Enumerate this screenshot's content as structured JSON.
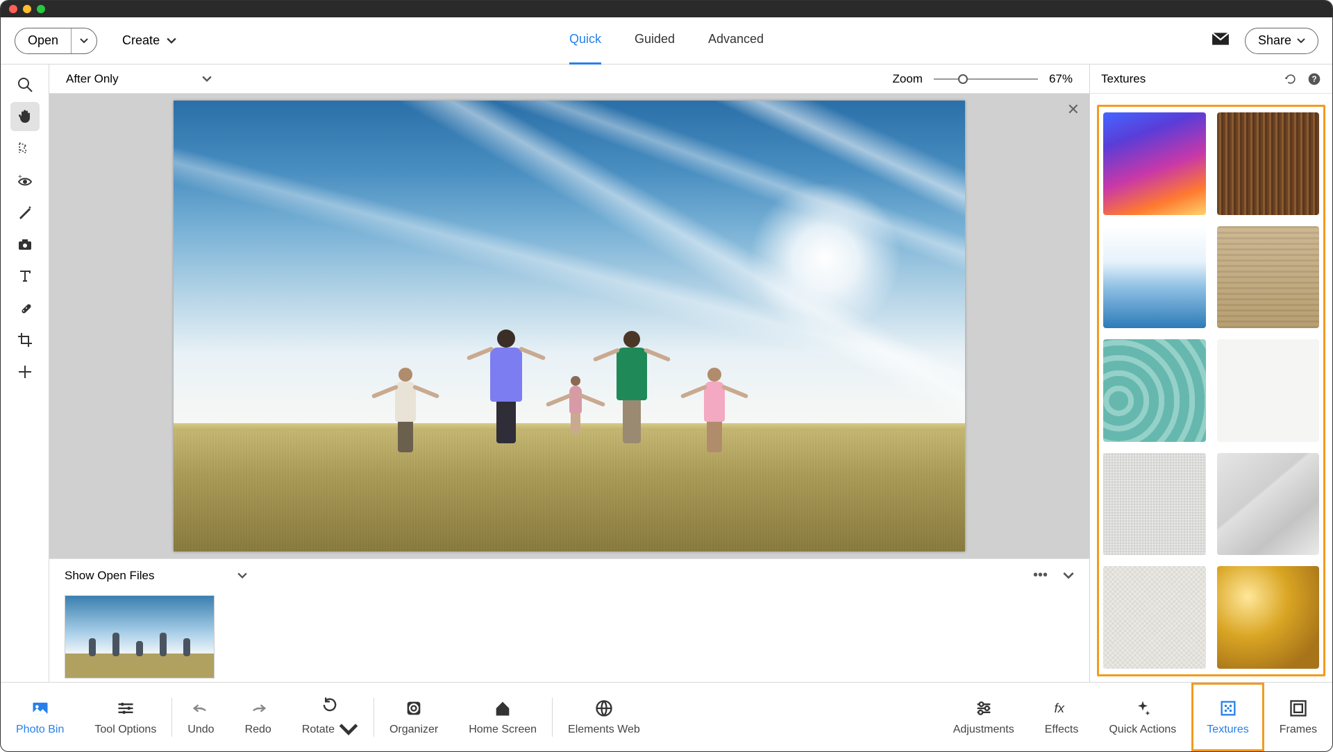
{
  "topbar": {
    "open": "Open",
    "create": "Create",
    "tabs": {
      "quick": "Quick",
      "guided": "Guided",
      "advanced": "Advanced"
    },
    "share": "Share"
  },
  "subbar": {
    "view_mode": "After Only",
    "zoom_label": "Zoom",
    "zoom_value": "67%",
    "zoom_pos_pct": 28
  },
  "left_tools": [
    {
      "name": "zoom-tool-icon"
    },
    {
      "name": "hand-tool-icon",
      "active": true
    },
    {
      "name": "quick-select-tool-icon"
    },
    {
      "name": "redeye-tool-icon"
    },
    {
      "name": "whiten-tool-icon"
    },
    {
      "name": "camera-tool-icon"
    },
    {
      "name": "type-tool-icon"
    },
    {
      "name": "healing-tool-icon"
    },
    {
      "name": "crop-tool-icon"
    },
    {
      "name": "move-tool-icon"
    }
  ],
  "right_panel": {
    "title": "Textures",
    "textures": [
      {
        "name": "gradient-sunset"
      },
      {
        "name": "wood-grain"
      },
      {
        "name": "blue-crystal"
      },
      {
        "name": "light-wood"
      },
      {
        "name": "teal-waves"
      },
      {
        "name": "paper-plain"
      },
      {
        "name": "brick-white"
      },
      {
        "name": "crumpled-paper"
      },
      {
        "name": "linen"
      },
      {
        "name": "gold-foil"
      }
    ]
  },
  "bin": {
    "label": "Show Open Files"
  },
  "bottombar": {
    "photo_bin": "Photo Bin",
    "tool_options": "Tool Options",
    "undo": "Undo",
    "redo": "Redo",
    "rotate": "Rotate",
    "organizer": "Organizer",
    "home_screen": "Home Screen",
    "elements_web": "Elements Web",
    "adjustments": "Adjustments",
    "effects": "Effects",
    "quick_actions": "Quick Actions",
    "textures": "Textures",
    "frames": "Frames"
  }
}
